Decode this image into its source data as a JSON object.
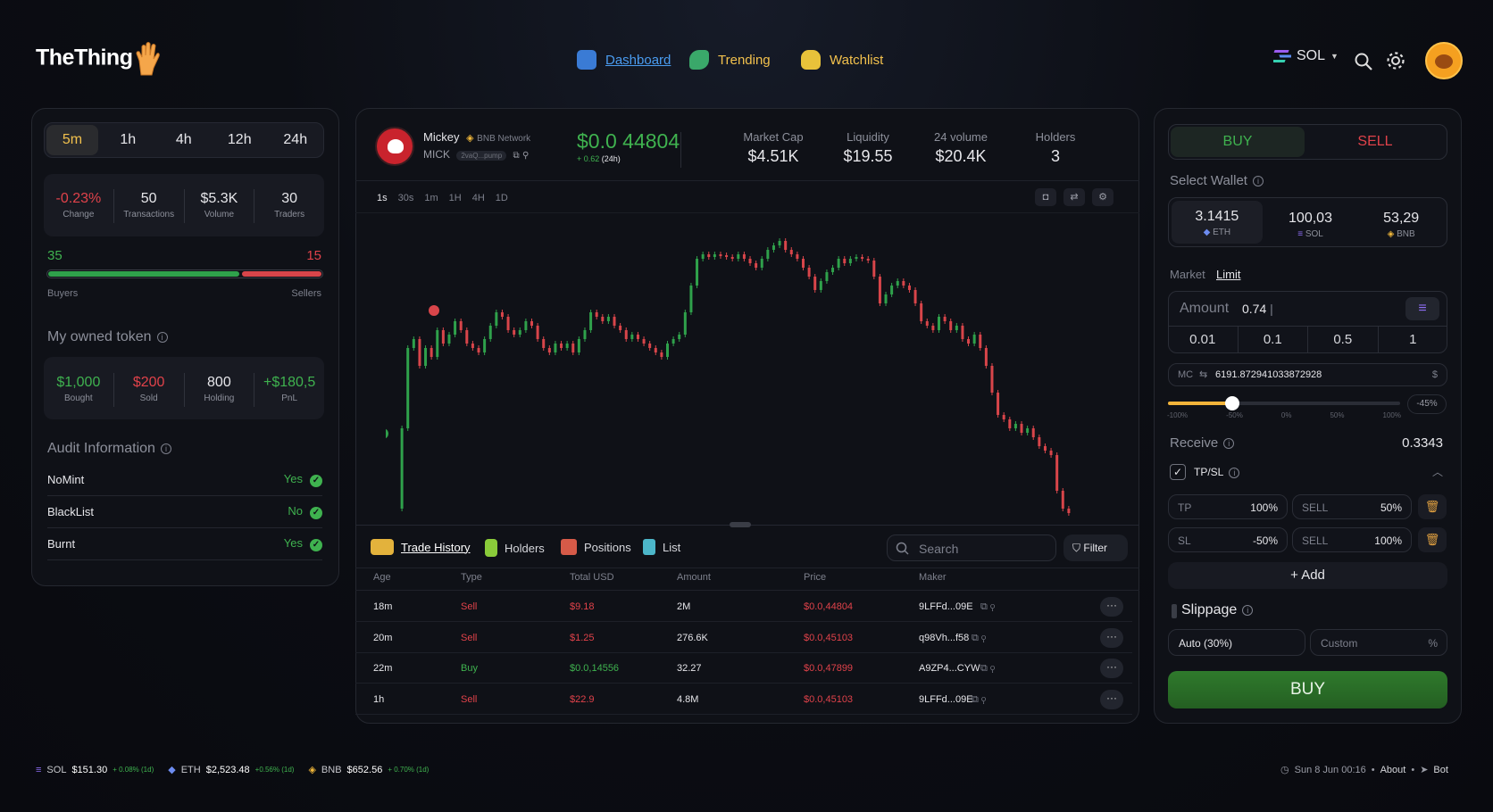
{
  "header": {
    "logo": "TheThing",
    "nav": [
      {
        "label": "Dashboard",
        "active": true
      },
      {
        "label": "Trending"
      },
      {
        "label": "Watchlist"
      }
    ],
    "chain": "SOL"
  },
  "left": {
    "timeframes": [
      "5m",
      "1h",
      "4h",
      "12h",
      "24h"
    ],
    "active_timeframe": "5m",
    "stats": [
      {
        "value": "-0.23%",
        "label": "Change"
      },
      {
        "value": "50",
        "label": "Transactions"
      },
      {
        "value": "$5.3K",
        "label": "Volume"
      },
      {
        "value": "30",
        "label": "Traders"
      }
    ],
    "buyers_count": "35",
    "sellers_count": "15",
    "buyers_label": "Buyers",
    "sellers_label": "Sellers",
    "buyers_ratio": 0.7,
    "owned_title": "My owned token",
    "owned": [
      {
        "value": "$1,000",
        "label": "Bought"
      },
      {
        "value": "$200",
        "label": "Sold"
      },
      {
        "value": "800",
        "label": "Holding"
      },
      {
        "value": "+$180,5",
        "label": "PnL"
      }
    ],
    "audit_title": "Audit Information",
    "audit": [
      {
        "label": "NoMint",
        "value": "Yes"
      },
      {
        "label": "BlackList",
        "value": "No"
      },
      {
        "label": "Burnt",
        "value": "Yes"
      }
    ]
  },
  "token": {
    "name": "Mickey",
    "network": "BNB Network",
    "symbol": "MICK",
    "address": "2vaQ...pump",
    "price": "$0.0 44804",
    "change": "+ 0.62",
    "change_period": "(24h)",
    "metrics": [
      {
        "label": "Market Cap",
        "value": "$4.51K"
      },
      {
        "label": "Liquidity",
        "value": "$19.55"
      },
      {
        "label": "24 volume",
        "value": "$20.4K"
      },
      {
        "label": "Holders",
        "value": "3"
      }
    ],
    "intervals": [
      "1s",
      "30s",
      "1m",
      "1H",
      "4H",
      "1D"
    ]
  },
  "trades": {
    "tabs": [
      "Trade History",
      "Holders",
      "Positions",
      "List"
    ],
    "search_placeholder": "Search",
    "filter": "Filter",
    "columns": [
      "Age",
      "Type",
      "Total USD",
      "Amount",
      "Price",
      "Maker"
    ],
    "rows": [
      {
        "age": "18m",
        "type": "Sell",
        "total": "$9.18",
        "amount": "2M",
        "price": "$0.0,44804",
        "maker": "9LFFd...09E"
      },
      {
        "age": "20m",
        "type": "Sell",
        "total": "$1.25",
        "amount": "276.6K",
        "price": "$0.0,45103",
        "maker": "q98Vh...f58"
      },
      {
        "age": "22m",
        "type": "Buy",
        "total": "$0.0,14556",
        "amount": "32.27",
        "price": "$0.0,47899",
        "maker": "A9ZP4...CYW"
      },
      {
        "age": "1h",
        "type": "Sell",
        "total": "$22.9",
        "amount": "4.8M",
        "price": "$0.0,45103",
        "maker": "9LFFd...09E"
      }
    ]
  },
  "order": {
    "buy": "BUY",
    "sell": "SELL",
    "select_wallet": "Select Wallet",
    "wallets": [
      {
        "value": "3.1415",
        "label": "ETH"
      },
      {
        "value": "100,03",
        "label": "SOL"
      },
      {
        "value": "53,29",
        "label": "BNB"
      }
    ],
    "market": "Market",
    "limit": "Limit",
    "amount_label": "Amount",
    "amount_value": "0.74",
    "presets": [
      "0.01",
      "0.1",
      "0.5",
      "1"
    ],
    "mc_label": "MC",
    "mc_value": "6191.872941033872928",
    "mc_unit": "$",
    "slider_ticks": [
      "-100%",
      "-50%",
      "0%",
      "50%",
      "100%"
    ],
    "slider_pct": "-45%",
    "receive_label": "Receive",
    "receive_value": "0.3343",
    "tpsl_label": "TP/SL",
    "tp": {
      "label": "TP",
      "value": "100%",
      "sell_label": "SELL",
      "sell_value": "50%"
    },
    "sl": {
      "label": "SL",
      "value": "-50%",
      "sell_label": "SELL",
      "sell_value": "100%"
    },
    "add": "+ Add",
    "slippage_label": "Slippage",
    "slippage_auto": "Auto (30%)",
    "slippage_custom": "Custom",
    "slippage_unit": "%",
    "submit": "BUY"
  },
  "footer": {
    "tickers": [
      {
        "sym": "SOL",
        "price": "$151.30",
        "chg": "+ 0.08% (1d)"
      },
      {
        "sym": "ETH",
        "price": "$2,523.48",
        "chg": "+0.56% (1d)"
      },
      {
        "sym": "BNB",
        "price": "$652.56",
        "chg": "+ 0.70% (1d)"
      }
    ],
    "datetime": "Sun 8 Jun 00:16",
    "about": "About",
    "bot": "Bot"
  }
}
